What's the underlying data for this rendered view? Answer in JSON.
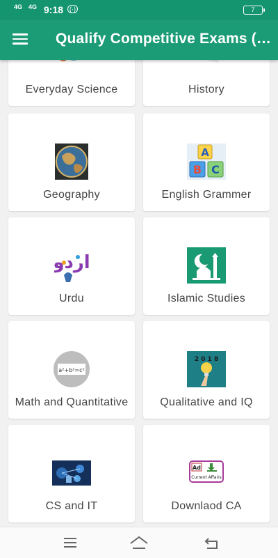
{
  "status_bar": {
    "signal_1": "4G",
    "signal_2": "4G",
    "time": "9:18",
    "wifi_badge": "(·)",
    "battery": "7"
  },
  "app_bar": {
    "title": "Qualify Competitive Exams (N..."
  },
  "categories": [
    {
      "label": "Everyday Science",
      "icon": "science-icon"
    },
    {
      "label": "History",
      "icon": "book-icon"
    },
    {
      "label": "Geography",
      "icon": "globe-icon"
    },
    {
      "label": "English Grammer",
      "icon": "abc-blocks-icon"
    },
    {
      "label": "Urdu",
      "icon": "urdu-calligraphy-icon"
    },
    {
      "label": "Islamic Studies",
      "icon": "mosque-icon"
    },
    {
      "label": "Math and Quantitative",
      "icon": "formula-icon"
    },
    {
      "label": "Qualitative and IQ",
      "icon": "lightbulb-icon"
    },
    {
      "label": "CS and IT",
      "icon": "network-icon"
    },
    {
      "label": "Downlaod CA",
      "icon": "current-affairs-icon"
    }
  ],
  "icon_texts": {
    "formula": "a²+b²=c²",
    "urdu": "اردو",
    "year": "2 0 1 8",
    "ad": "Ad",
    "current_affairs": "Current Affairs",
    "abc": [
      "A",
      "B",
      "C"
    ]
  },
  "colors": {
    "primary": "#1b9b76",
    "status_bar": "#15956f"
  }
}
